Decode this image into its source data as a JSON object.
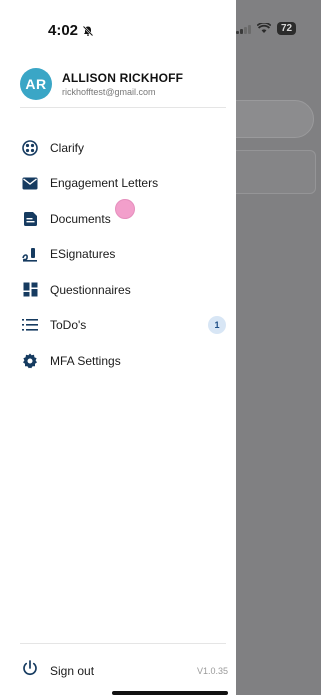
{
  "status": {
    "time": "4:02",
    "battery": "72"
  },
  "profile": {
    "initials": "AR",
    "name": "ALLISON RICKHOFF",
    "email": "rickhofftest@gmail.com"
  },
  "menu": [
    {
      "label": "Clarify",
      "icon": "clarify-icon"
    },
    {
      "label": "Engagement Letters",
      "icon": "envelope-icon"
    },
    {
      "label": "Documents",
      "icon": "document-icon"
    },
    {
      "label": "ESignatures",
      "icon": "signature-icon"
    },
    {
      "label": "Questionnaires",
      "icon": "grid-icon"
    },
    {
      "label": "ToDo's",
      "icon": "list-icon",
      "badge": "1"
    },
    {
      "label": "MFA Settings",
      "icon": "gear-icon"
    }
  ],
  "footer": {
    "sign_out_label": "Sign out",
    "version": "V1.0.35"
  },
  "colors": {
    "accent": "#163b60",
    "avatar": "#3aa6c6",
    "badge_bg": "#d8e6f5",
    "overlay": "#808082"
  }
}
